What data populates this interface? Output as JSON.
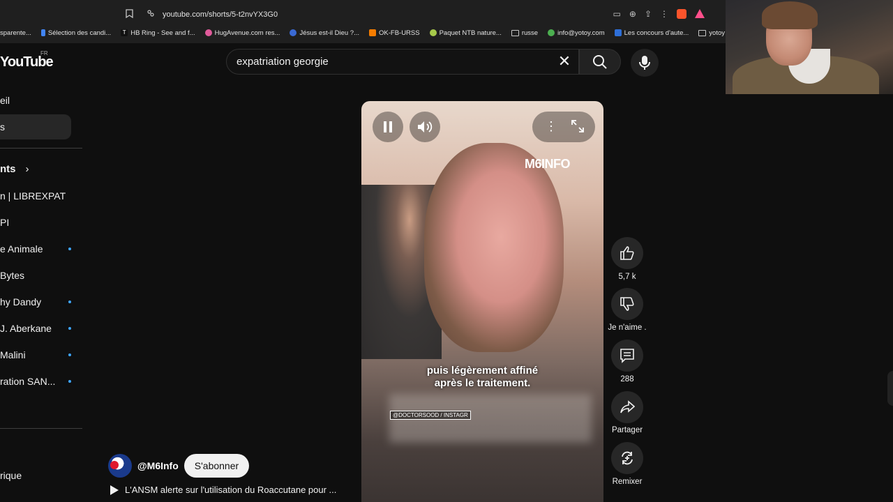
{
  "browser": {
    "url": "youtube.com/shorts/5-t2nvYX3G0",
    "bookmarks": [
      {
        "label": "sparente...",
        "color": "#3c3c3c"
      },
      {
        "label": "Sélection des candi...",
        "color": "#4285f4"
      },
      {
        "label": "HB Ring - See and f...",
        "color": "#111111"
      },
      {
        "label": "HugAvenue.com res...",
        "color": "#e05a9a"
      },
      {
        "label": "Jésus est-il Dieu ?...",
        "color": "#3a6ad4"
      },
      {
        "label": "OK-FB-URSS",
        "color": "#f57c00"
      },
      {
        "label": "Paquet NTB nature...",
        "color": "#a6c94a"
      },
      {
        "label": "russe",
        "color": "folder"
      },
      {
        "label": "info@yotoy.com",
        "color": "#4caf50"
      },
      {
        "label": "Les concours d'aute...",
        "color": "#2e6fd8"
      },
      {
        "label": "yotoy",
        "color": "folder"
      }
    ]
  },
  "youtube": {
    "logo": "YouTube",
    "region": "FR",
    "search_query": "expatriation georgie"
  },
  "sidebar": {
    "items": [
      {
        "label": "eil",
        "active": false,
        "dot": false
      },
      {
        "label": "s",
        "active": true,
        "dot": false
      },
      {
        "label": "nts",
        "active": false,
        "dot": false,
        "heading": true
      },
      {
        "label": "n | LIBREXPAT",
        "active": false,
        "dot": false
      },
      {
        "label": "PI",
        "active": false,
        "dot": false
      },
      {
        "label": "e Animale",
        "active": false,
        "dot": true
      },
      {
        "label": "Bytes",
        "active": false,
        "dot": false
      },
      {
        "label": "hy Dandy",
        "active": false,
        "dot": true
      },
      {
        "label": "J. Aberkane",
        "active": false,
        "dot": true
      },
      {
        "label": "Malini",
        "active": false,
        "dot": true
      },
      {
        "label": "ration SAN...",
        "active": false,
        "dot": true
      },
      {
        "label": "rique",
        "active": false,
        "dot": false
      }
    ]
  },
  "video": {
    "brand": "M6INFO",
    "caption_line1": "puis légèrement affiné",
    "caption_line2": "après le traitement.",
    "credit": "@DOCTORSOOD / INSTAGR"
  },
  "actions": {
    "likes": "5,7 k",
    "dislike_label": "Je n'aime .",
    "comments": "288",
    "share_label": "Partager",
    "remix_label": "Remixer"
  },
  "channel": {
    "handle": "@M6Info",
    "subscribe_label": "S'abonner",
    "video_title": "L'ANSM alerte sur l'utilisation du Roaccutane pour ..."
  }
}
